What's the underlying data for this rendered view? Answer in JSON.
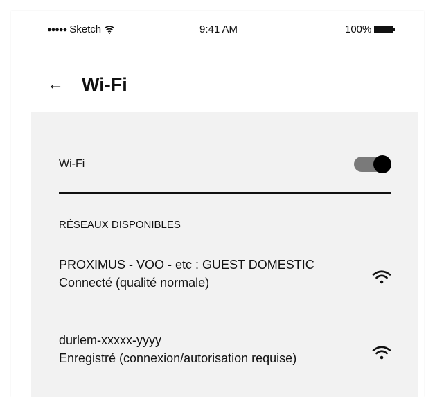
{
  "status_bar": {
    "signal_dots": "●●●●●",
    "carrier": "Sketch",
    "time": "9:41 AM",
    "battery": "100%"
  },
  "header": {
    "back_icon": "←",
    "title": "Wi-Fi"
  },
  "wifi": {
    "label": "Wi-Fi",
    "enabled": true
  },
  "networks_section": {
    "title": "RÉSEAUX DISPONIBLES",
    "items": [
      {
        "name": "PROXIMUS - VOO - etc : GUEST DOMESTIC",
        "status": "Connecté (qualité normale)",
        "icon": "wifi-signal-icon"
      },
      {
        "name": "durlem-xxxxx-yyyy",
        "status": "Enregistré (connexion/autorisation requise)",
        "icon": "wifi-signal-icon"
      }
    ]
  },
  "colors": {
    "panel_bg": "#f2f2f2",
    "toggle_track": "#7a7a7a",
    "toggle_knob": "#000000",
    "divider": "#c9c9c9"
  }
}
